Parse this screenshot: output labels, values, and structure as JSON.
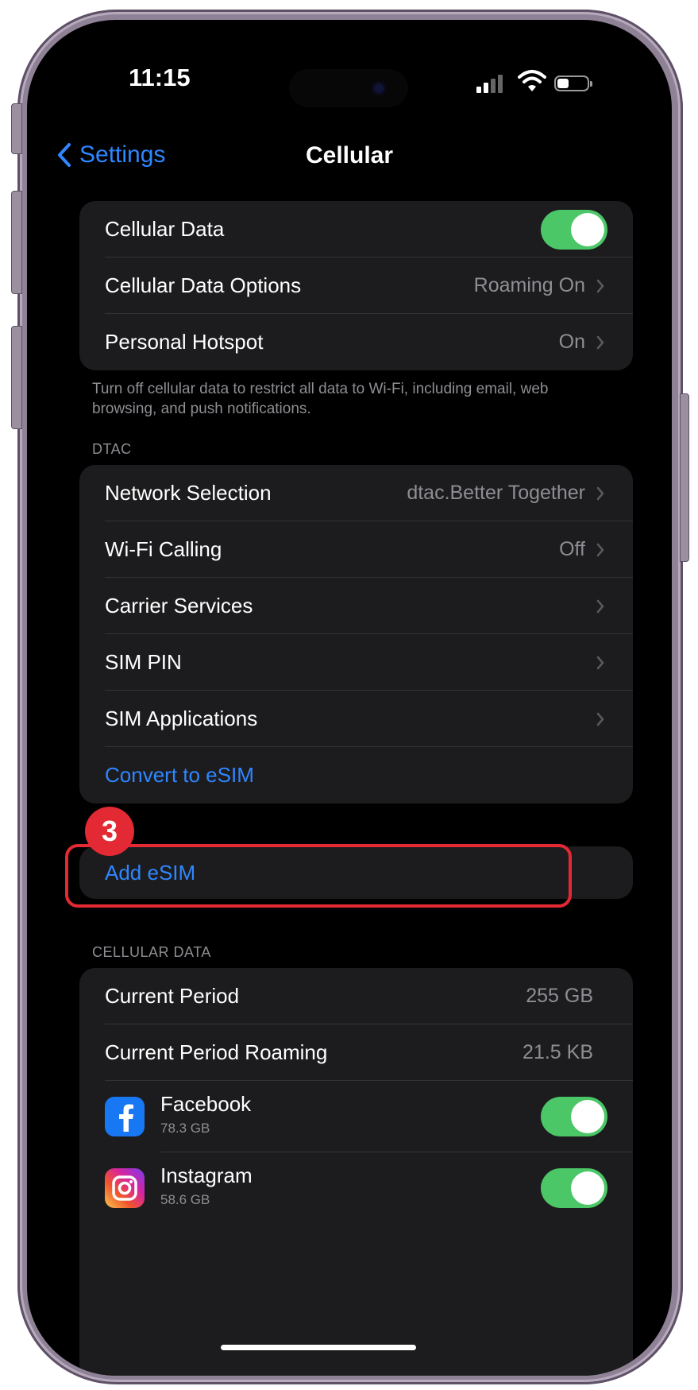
{
  "status_bar": {
    "time": "11:15"
  },
  "nav": {
    "back_label": "Settings",
    "title": "Cellular"
  },
  "group1": {
    "cellular_data": {
      "label": "Cellular Data",
      "toggle_on": true
    },
    "cellular_data_options": {
      "label": "Cellular Data Options",
      "value": "Roaming On"
    },
    "personal_hotspot": {
      "label": "Personal Hotspot",
      "value": "On"
    }
  },
  "group1_footer": "Turn off cellular data to restrict all data to Wi-Fi, including email, web browsing, and push notifications.",
  "dtac_header": "DTAC",
  "group2": {
    "network_selection": {
      "label": "Network Selection",
      "value": "dtac.Better Together"
    },
    "wifi_calling": {
      "label": "Wi-Fi Calling",
      "value": "Off"
    },
    "carrier_services": {
      "label": "Carrier Services"
    },
    "sim_pin": {
      "label": "SIM PIN"
    },
    "sim_applications": {
      "label": "SIM Applications"
    },
    "convert_esim": {
      "label": "Convert to eSIM"
    }
  },
  "step_badge": "3",
  "add_esim": {
    "label": "Add eSIM"
  },
  "usage_header": "CELLULAR DATA",
  "usage": {
    "current_period": {
      "label": "Current Period",
      "value": "255 GB"
    },
    "current_period_roaming": {
      "label": "Current Period Roaming",
      "value": "21.5 KB"
    },
    "apps": [
      {
        "name": "Facebook",
        "size": "78.3 GB",
        "icon": "facebook-icon",
        "toggle_on": true
      },
      {
        "name": "Instagram",
        "size": "58.6 GB",
        "icon": "instagram-icon",
        "toggle_on": true
      }
    ]
  },
  "colors": {
    "accent": "#2f86ff",
    "toggle_on": "#4bc767",
    "highlight": "#e32933",
    "cell_bg": "#1c1c1e"
  }
}
